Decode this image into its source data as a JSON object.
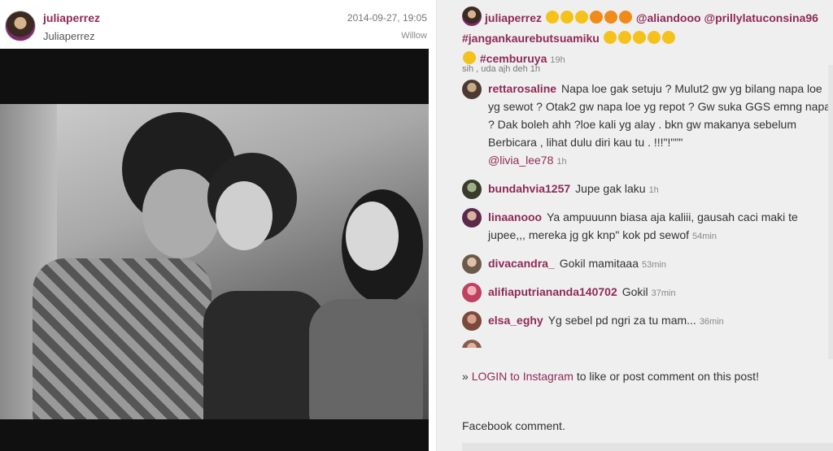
{
  "post": {
    "username": "juliaperrez",
    "full_name": "Juliaperrez",
    "date": "2014-09-27, 19:05",
    "filter": "Willow"
  },
  "caption": {
    "username": "juliaperrez",
    "mention1": "@aliandooo",
    "mention2": "@prillylatuconsina96",
    "hashtag1": "#jangankaurebutsuamiku",
    "hashtag2": "#cemburuya",
    "time": "19h"
  },
  "comments": {
    "partial_text": "sih , uda ajh deh 1h",
    "items": [
      {
        "user": "rettarosaline",
        "text": "Napa loe gak setuju ? Mulut2 gw yg bilang napa loe yg sewot ? Otak2 gw napa loe yg repot ? Gw suka GGS emng napa ? Dak boleh ahh ?loe kali yg alay . bkn gw makanya sebelum Berbicara , lihat dulu diri kau tu . !!!\"!\"\"\"",
        "mention": "@livia_lee78",
        "time": "1h"
      },
      {
        "user": "bundahvia1257",
        "text": "Jupe gak laku",
        "time": "1h"
      },
      {
        "user": "linaanooo",
        "text": "Ya ampuuunn biasa aja kaliii, gausah caci maki te jupee,,, mereka jg gk knp\" kok pd sewof",
        "time": "54min"
      },
      {
        "user": "divacandra_",
        "text": "Gokil mamitaaa",
        "time": "53min"
      },
      {
        "user": "alifiaputriananda140702",
        "text": "Gokil",
        "time": "37min"
      },
      {
        "user": "elsa_eghy",
        "text": "Yg sebel pd ngri za tu mam...",
        "time": "36min"
      }
    ]
  },
  "login": {
    "prefix": "» ",
    "link": "LOGIN to Instagram",
    "suffix": " to like or post comment on this post!"
  },
  "facebook": {
    "label": "Facebook comment."
  },
  "colors": {
    "username": "#8f2a56",
    "emoji": "#f5c21b"
  }
}
